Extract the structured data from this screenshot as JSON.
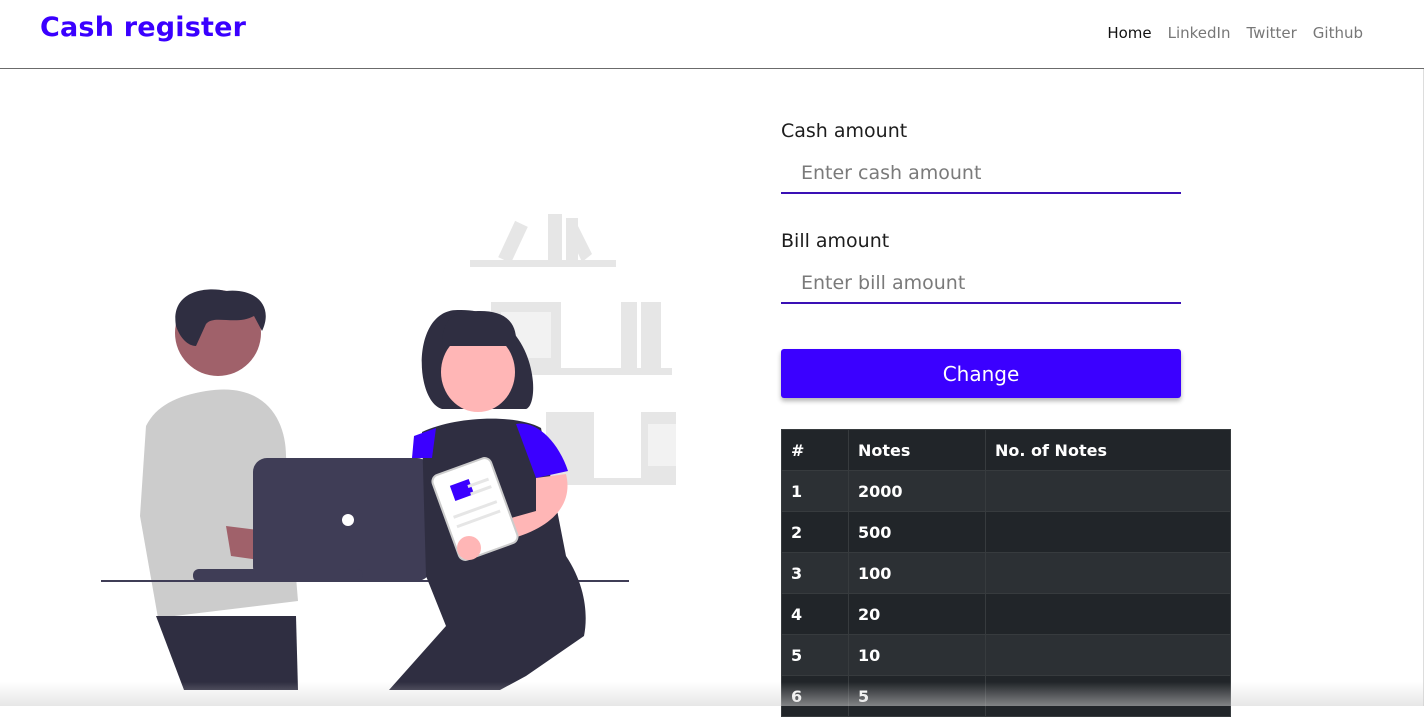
{
  "brand": "Cash register",
  "nav": {
    "items": [
      "Home",
      "LinkedIn",
      "Twitter",
      "Github"
    ]
  },
  "form": {
    "cash_label": "Cash amount",
    "cash_placeholder": "Enter cash amount",
    "cash_value": "",
    "bill_label": "Bill amount",
    "bill_placeholder": "Enter bill amount",
    "bill_value": "",
    "button_label": "Change"
  },
  "table": {
    "headers": [
      "#",
      "Notes",
      "No. of Notes"
    ],
    "rows": [
      [
        "1",
        "2000",
        ""
      ],
      [
        "2",
        "500",
        ""
      ],
      [
        "3",
        "100",
        ""
      ],
      [
        "4",
        "20",
        ""
      ],
      [
        "5",
        "10",
        ""
      ],
      [
        "6",
        "5",
        ""
      ]
    ]
  },
  "colors": {
    "brand": "#3a00ff",
    "button": "#3b00ff",
    "table_dark": "#212529",
    "table_stripe": "#2c3034"
  }
}
